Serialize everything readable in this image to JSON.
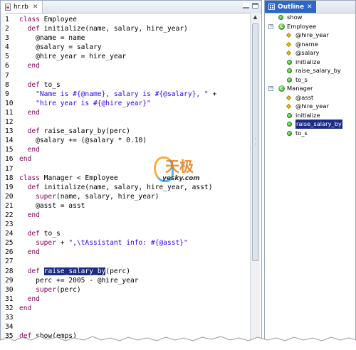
{
  "editor": {
    "tab_label": "hr.rb",
    "close_glyph": "✕",
    "lines": [
      {
        "n": "1",
        "toks": [
          [
            "kw",
            "class"
          ],
          [
            "pln",
            " Employee"
          ]
        ]
      },
      {
        "n": "2",
        "toks": [
          [
            "pln",
            "  "
          ],
          [
            "kw",
            "def"
          ],
          [
            "pln",
            " initialize(name, salary, hire_year)"
          ]
        ]
      },
      {
        "n": "3",
        "toks": [
          [
            "pln",
            "    @name = name"
          ]
        ]
      },
      {
        "n": "4",
        "toks": [
          [
            "pln",
            "    @salary = salary"
          ]
        ]
      },
      {
        "n": "5",
        "toks": [
          [
            "pln",
            "    @hire_year = hire_year"
          ]
        ]
      },
      {
        "n": "6",
        "toks": [
          [
            "pln",
            "  "
          ],
          [
            "kw",
            "end"
          ]
        ]
      },
      {
        "n": "7",
        "toks": []
      },
      {
        "n": "8",
        "toks": [
          [
            "pln",
            "  "
          ],
          [
            "kw",
            "def"
          ],
          [
            "pln",
            " to_s"
          ]
        ]
      },
      {
        "n": "9",
        "toks": [
          [
            "pln",
            "    "
          ],
          [
            "str",
            "\"Name is #{@name}, salary is #{@salary}, \""
          ],
          [
            "pln",
            " +"
          ]
        ]
      },
      {
        "n": "10",
        "toks": [
          [
            "pln",
            "    "
          ],
          [
            "str",
            "\"hire year is #{@hire_year}\""
          ]
        ]
      },
      {
        "n": "11",
        "toks": [
          [
            "pln",
            "  "
          ],
          [
            "kw",
            "end"
          ]
        ]
      },
      {
        "n": "12",
        "toks": []
      },
      {
        "n": "13",
        "toks": [
          [
            "pln",
            "  "
          ],
          [
            "kw",
            "def"
          ],
          [
            "pln",
            " raise_salary_by(perc)"
          ]
        ]
      },
      {
        "n": "14",
        "toks": [
          [
            "pln",
            "    @salary += (@salary * 0.10)"
          ]
        ]
      },
      {
        "n": "15",
        "toks": [
          [
            "pln",
            "  "
          ],
          [
            "kw",
            "end"
          ]
        ]
      },
      {
        "n": "16",
        "toks": [
          [
            "kw",
            "end"
          ]
        ]
      },
      {
        "n": "17",
        "toks": []
      },
      {
        "n": "18",
        "toks": [
          [
            "kw",
            "class"
          ],
          [
            "pln",
            " Manager < Employee"
          ]
        ]
      },
      {
        "n": "19",
        "toks": [
          [
            "pln",
            "  "
          ],
          [
            "kw",
            "def"
          ],
          [
            "pln",
            " initialize(name, salary, hire_year, asst)"
          ]
        ]
      },
      {
        "n": "20",
        "toks": [
          [
            "pln",
            "    "
          ],
          [
            "kw",
            "super"
          ],
          [
            "pln",
            "(name, salary, hire_year)"
          ]
        ]
      },
      {
        "n": "21",
        "toks": [
          [
            "pln",
            "    @asst = asst"
          ]
        ]
      },
      {
        "n": "22",
        "toks": [
          [
            "pln",
            "  "
          ],
          [
            "kw",
            "end"
          ]
        ]
      },
      {
        "n": "23",
        "toks": []
      },
      {
        "n": "24",
        "toks": [
          [
            "pln",
            "  "
          ],
          [
            "kw",
            "def"
          ],
          [
            "pln",
            " to_s"
          ]
        ]
      },
      {
        "n": "25",
        "toks": [
          [
            "pln",
            "    "
          ],
          [
            "kw",
            "super"
          ],
          [
            "pln",
            " + "
          ],
          [
            "str",
            "\",\\tAssistant info: #{@asst}\""
          ]
        ]
      },
      {
        "n": "26",
        "toks": [
          [
            "pln",
            "  "
          ],
          [
            "kw",
            "end"
          ]
        ]
      },
      {
        "n": "27",
        "toks": []
      },
      {
        "n": "28",
        "toks": [
          [
            "pln",
            "  "
          ],
          [
            "kw",
            "def"
          ],
          [
            "pln",
            " "
          ],
          [
            "sel",
            "raise_salary_by"
          ],
          [
            "pln",
            "(perc)"
          ]
        ]
      },
      {
        "n": "29",
        "toks": [
          [
            "pln",
            "    perc += 2005 - @hire_year"
          ]
        ]
      },
      {
        "n": "30",
        "toks": [
          [
            "pln",
            "    "
          ],
          [
            "kw",
            "super"
          ],
          [
            "pln",
            "(perc)"
          ]
        ]
      },
      {
        "n": "31",
        "toks": [
          [
            "pln",
            "  "
          ],
          [
            "kw",
            "end"
          ]
        ]
      },
      {
        "n": "32",
        "toks": [
          [
            "kw",
            "end"
          ]
        ]
      },
      {
        "n": "33",
        "toks": []
      },
      {
        "n": "34",
        "toks": []
      },
      {
        "n": "35",
        "toks": [
          [
            "kw",
            "def"
          ],
          [
            "pln",
            " show(emps)"
          ]
        ]
      }
    ]
  },
  "outline": {
    "tab_label": "Outline",
    "close_glyph": "✕",
    "nodes": [
      {
        "label": "show",
        "icon": "method-icon",
        "depth": 0,
        "expander": ""
      },
      {
        "label": "Employee",
        "icon": "class-icon",
        "depth": 0,
        "expander": "−"
      },
      {
        "label": "@hire_year",
        "icon": "field-icon",
        "depth": 1,
        "expander": ""
      },
      {
        "label": "@name",
        "icon": "field-icon",
        "depth": 1,
        "expander": ""
      },
      {
        "label": "@salary",
        "icon": "field-icon",
        "depth": 1,
        "expander": ""
      },
      {
        "label": "initialize",
        "icon": "method-icon",
        "depth": 1,
        "expander": ""
      },
      {
        "label": "raise_salary_by",
        "icon": "method-icon",
        "depth": 1,
        "expander": ""
      },
      {
        "label": "to_s",
        "icon": "method-icon",
        "depth": 1,
        "expander": ""
      },
      {
        "label": "Manager",
        "icon": "class-icon",
        "depth": 0,
        "expander": "−"
      },
      {
        "label": "@asst",
        "icon": "field-icon",
        "depth": 1,
        "expander": ""
      },
      {
        "label": "@hire_year",
        "icon": "field-icon",
        "depth": 1,
        "expander": ""
      },
      {
        "label": "initialize",
        "icon": "method-icon",
        "depth": 1,
        "expander": ""
      },
      {
        "label": "raise_salary_by",
        "icon": "method-icon",
        "depth": 1,
        "expander": "",
        "selected": true
      },
      {
        "label": "to_s",
        "icon": "method-icon",
        "depth": 1,
        "expander": ""
      }
    ]
  },
  "watermark": {
    "brand_cn": "天极",
    "url": "yesky.com"
  },
  "colors": {
    "keyword": "#7f0055",
    "string": "#2a00ff",
    "selection": "#1c2b84",
    "outline_tab": "#2f67c8"
  }
}
